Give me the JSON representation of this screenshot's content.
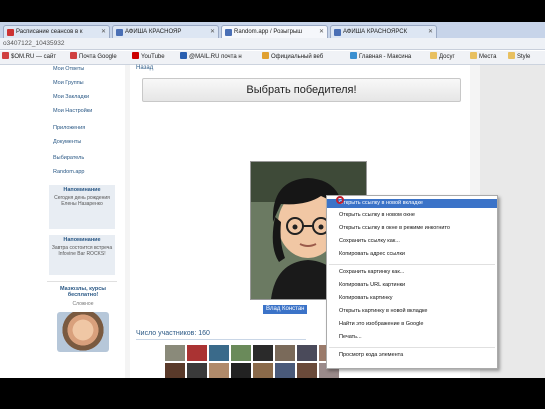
{
  "tabs": [
    {
      "label": "Расписание сеансов в к",
      "active": false,
      "favicon": "#cc3333"
    },
    {
      "label": "АФИША КРАСНОЯР",
      "active": false,
      "favicon": "#4a6fb5"
    },
    {
      "label": "Random.app / Розыгрыш",
      "active": true,
      "favicon": "#4a6fb5"
    },
    {
      "label": "АФИША КРАСНОЯРСК",
      "active": false,
      "favicon": "#4a6fb5"
    }
  ],
  "address": "o3407122_10435932",
  "bookmarks": [
    {
      "label": "$OM.RU — сайт",
      "color": "#d04040"
    },
    {
      "label": "Почта Google",
      "color": "#d04040"
    },
    {
      "label": "YouTube",
      "color": "#cc0000"
    },
    {
      "label": "@MAIL.RU почта н",
      "color": "#2a5fb0"
    },
    {
      "label": "Официальный веб",
      "color": "#e0a030"
    },
    {
      "label": "Главная - Максина",
      "color": "#3a8fd0"
    },
    {
      "label": "Досуг",
      "color": "#e8c060"
    },
    {
      "label": "Места",
      "color": "#e8c060"
    },
    {
      "label": "Style",
      "color": "#e8c060"
    }
  ],
  "left_nav": [
    "Мои Ответы",
    "Мои Группы",
    "Мои Закладки",
    "Мои Настройки",
    "Приложения",
    "Документы",
    "Выбиратель",
    "Random.app"
  ],
  "blocks": [
    {
      "title": "Напоминание",
      "text": "Сегодня день рождения Елены Назаренко"
    },
    {
      "title": "Напоминание",
      "text": "Завтра состоится встреча Infovine Bar ROCKS!"
    }
  ],
  "promo": {
    "title": "Мазюзлы, курсы бесплатно!",
    "subtitle": "Сложное"
  },
  "main": {
    "back": "Назад",
    "pick_button": "Выбрать победителя!",
    "winner_name": "Влад Констан",
    "participants": "Число участников: 160"
  },
  "context_menu": [
    "Открыть ссылку в новой вкладке",
    "Открыть ссылку в новом окне",
    "Открыть ссылку в окне в режиме инкогнито",
    "Сохранить ссылку как...",
    "Копировать адрес ссылки",
    "Сохранить картинку как...",
    "Копировать URL картинки",
    "Копировать картинку",
    "Открыть картинку в новой вкладке",
    "Найти это изображение в Google",
    "Печать...",
    "Просмотр кода элемента"
  ],
  "colors": {
    "accent": "#2a5885",
    "highlight": "#3b73c8"
  }
}
